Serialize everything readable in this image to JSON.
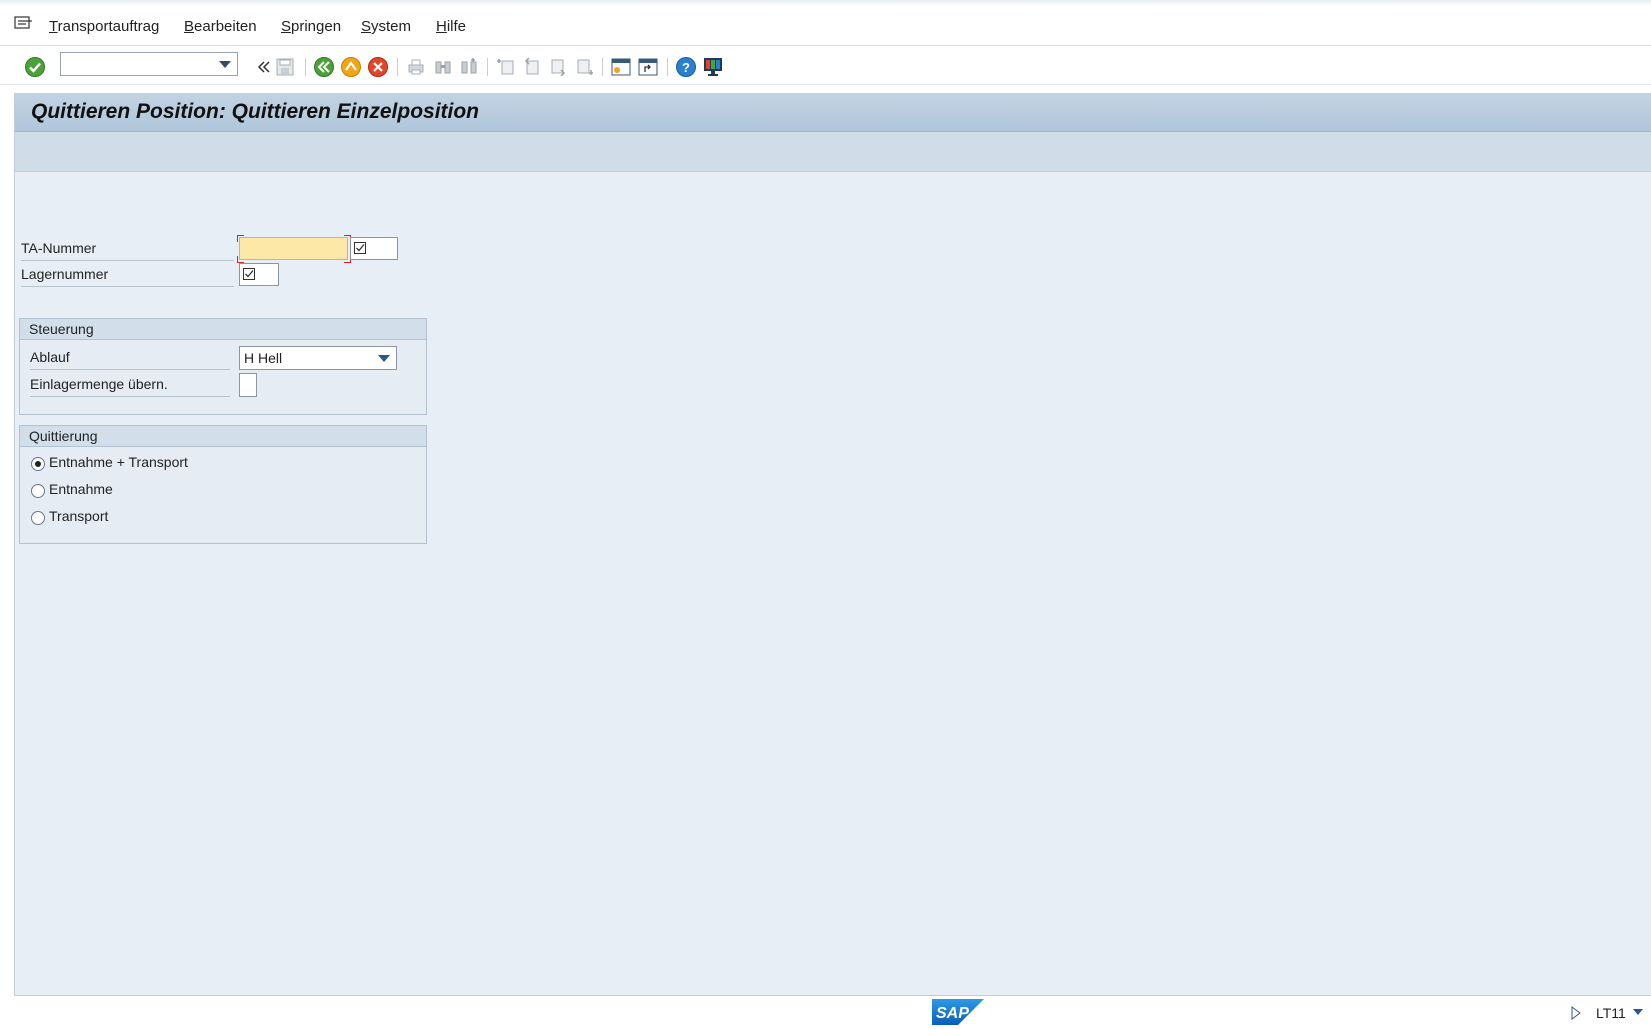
{
  "menu": {
    "items": [
      {
        "label": "Transportauftrag",
        "mnemonic": "T",
        "rest": "ransportauftrag"
      },
      {
        "label": "Bearbeiten",
        "mnemonic": "B",
        "rest": "earbeiten"
      },
      {
        "label": "Springen",
        "mnemonic": "S",
        "rest": "pringen"
      },
      {
        "label": "System",
        "mnemonic": "S",
        "rest": "ystem"
      },
      {
        "label": "Hilfe",
        "mnemonic": "H",
        "rest": "ilfe"
      }
    ]
  },
  "toolbar": {
    "command_field_value": "",
    "icons": [
      "enter-icon",
      "command-dropdown-icon",
      "collapse-icon",
      "save-icon",
      "back-icon",
      "exit-icon",
      "cancel-icon",
      "print-icon",
      "find-icon",
      "find-next-icon",
      "first-page-icon",
      "previous-page-icon",
      "next-page-icon",
      "last-page-icon",
      "new-session-icon",
      "shortcut-icon",
      "help-icon",
      "customize-layout-icon"
    ]
  },
  "page": {
    "title": "Quittieren Position: Quittieren Einzelposition"
  },
  "form": {
    "ta_nummer_label": "TA-Nummer",
    "ta_nummer_value": "",
    "lagernummer_label": "Lagernummer",
    "lagernummer_value": ""
  },
  "steuerung": {
    "title": "Steuerung",
    "ablauf_label": "Ablauf",
    "ablauf_value": "H Hell",
    "einlagermenge_label": "Einlagermenge übern.",
    "einlagermenge_checked": false
  },
  "quittierung": {
    "title": "Quittierung",
    "options": [
      {
        "label": "Entnahme + Transport",
        "selected": true
      },
      {
        "label": "Entnahme",
        "selected": false
      },
      {
        "label": "Transport",
        "selected": false
      }
    ]
  },
  "status": {
    "brand": "SAP",
    "transaction": "LT11"
  },
  "colors": {
    "title_bar": "#b8ccdf",
    "background": "#e8eef5",
    "required_field": "#fde8a8",
    "sap_blue": "#1a73c9"
  }
}
